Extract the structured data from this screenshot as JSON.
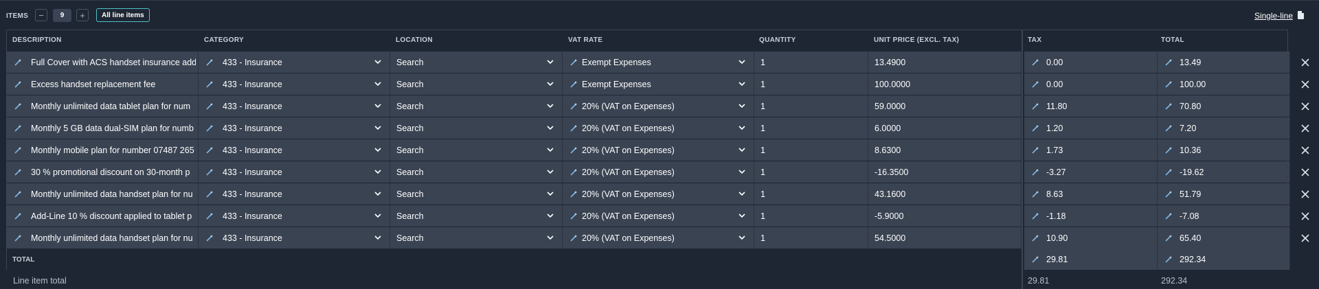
{
  "toolbar": {
    "items_label": "ITEMS",
    "minus": "−",
    "count": "9",
    "plus": "+",
    "all_line_items": "All line items",
    "single_line": "Single-line"
  },
  "columns": {
    "description": "DESCRIPTION",
    "category": "CATEGORY",
    "location": "LOCATION",
    "vat_rate": "VAT RATE",
    "quantity": "QUANTITY",
    "unit_price": "UNIT PRICE (EXCL. TAX)",
    "tax": "TAX",
    "total": "TOTAL"
  },
  "rows": [
    {
      "description": "Full Cover with ACS handset insurance add",
      "category": "433 - Insurance",
      "location": "Search",
      "vat": "Exempt Expenses",
      "quantity": "1",
      "unit_price": "13.4900",
      "tax": "0.00",
      "total": "13.49"
    },
    {
      "description": "Excess handset replacement fee",
      "category": "433 - Insurance",
      "location": "Search",
      "vat": "Exempt Expenses",
      "quantity": "1",
      "unit_price": "100.0000",
      "tax": "0.00",
      "total": "100.00"
    },
    {
      "description": "Monthly unlimited data tablet plan for num",
      "category": "433 - Insurance",
      "location": "Search",
      "vat": "20% (VAT on Expenses)",
      "quantity": "1",
      "unit_price": "59.0000",
      "tax": "11.80",
      "total": "70.80"
    },
    {
      "description": "Monthly 5 GB data dual-SIM plan for numb",
      "category": "433 - Insurance",
      "location": "Search",
      "vat": "20% (VAT on Expenses)",
      "quantity": "1",
      "unit_price": "6.0000",
      "tax": "1.20",
      "total": "7.20"
    },
    {
      "description": "Monthly mobile plan for number 07487 265",
      "category": "433 - Insurance",
      "location": "Search",
      "vat": "20% (VAT on Expenses)",
      "quantity": "1",
      "unit_price": "8.6300",
      "tax": "1.73",
      "total": "10.36"
    },
    {
      "description": "30 % promotional discount on 30-month p",
      "category": "433 - Insurance",
      "location": "Search",
      "vat": "20% (VAT on Expenses)",
      "quantity": "1",
      "unit_price": "-16.3500",
      "tax": "-3.27",
      "total": "-19.62"
    },
    {
      "description": "Monthly unlimited data handset plan for nu",
      "category": "433 - Insurance",
      "location": "Search",
      "vat": "20% (VAT on Expenses)",
      "quantity": "1",
      "unit_price": "43.1600",
      "tax": "8.63",
      "total": "51.79"
    },
    {
      "description": "Add-Line 10 % discount applied to tablet p",
      "category": "433 - Insurance",
      "location": "Search",
      "vat": "20% (VAT on Expenses)",
      "quantity": "1",
      "unit_price": "-5.9000",
      "tax": "-1.18",
      "total": "-7.08"
    },
    {
      "description": "Monthly unlimited data handset plan for nu",
      "category": "433 - Insurance",
      "location": "Search",
      "vat": "20% (VAT on Expenses)",
      "quantity": "1",
      "unit_price": "54.5000",
      "tax": "10.90",
      "total": "65.40"
    }
  ],
  "totals": {
    "label": "TOTAL",
    "tax": "29.81",
    "total": "292.34",
    "line_item_label": "Line item total",
    "line_item_tax": "29.81",
    "line_item_total": "292.34"
  },
  "icons": {
    "wand": "magic-wand-icon",
    "chevron": "chevron-down-icon",
    "remove": "close-icon",
    "document": "document-icon"
  },
  "colors": {
    "background": "#1e2633",
    "cell": "#3a4352",
    "accent": "#4fc1c8",
    "wand": "#7fb8e6"
  }
}
